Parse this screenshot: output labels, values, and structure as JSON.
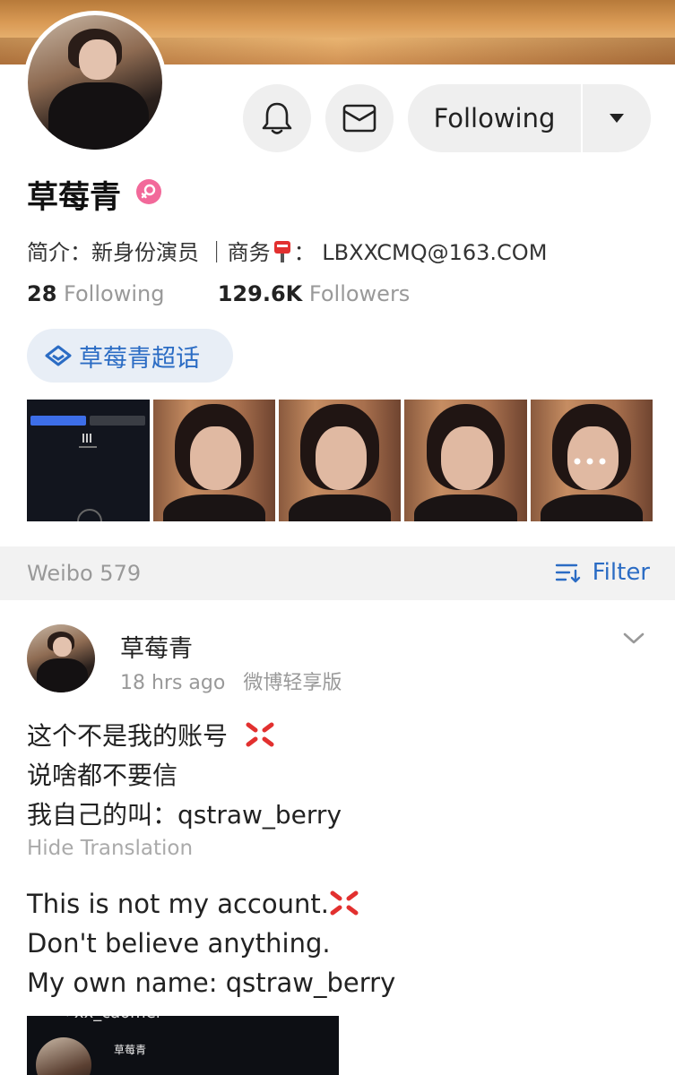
{
  "profile": {
    "name": "草莓青",
    "bio_prefix": "简介：",
    "bio_role": "新身份演员",
    "bio_sep": "｜商务",
    "bio_colon": "：",
    "email": "LBXXCMQ@163.COM",
    "following_count": "28",
    "following_label": "Following",
    "followers_count": "129.6K",
    "followers_label": "Followers",
    "super_topic": "草莓青超话"
  },
  "actions": {
    "follow_label": "Following",
    "bell_icon": "bell-icon",
    "message_icon": "message-icon",
    "dropdown_icon": "triangle-down-icon"
  },
  "feed": {
    "count_label": "Weibo 579",
    "filter_label": "Filter"
  },
  "post": {
    "author": "草莓青",
    "time": "18 hrs ago",
    "source": "微博轻享版",
    "line1": "这个不是我的账号",
    "line2": "说啥都不要信",
    "line3": "我自己的叫：qstraw_berry",
    "hide_translation": "Hide Translation",
    "tr_line1": "This is not my account.",
    "tr_line2": "Don't believe anything.",
    "tr_line3": "My own name: qstraw_berry",
    "emoji": "anger-symbol"
  },
  "embedded_screenshot": {
    "top_text": "xx_caomei",
    "name_text": "草莓青"
  },
  "colors": {
    "accent_blue": "#2b6cc4",
    "gender_pink": "#f2699a",
    "anger_red": "#e2302f"
  }
}
